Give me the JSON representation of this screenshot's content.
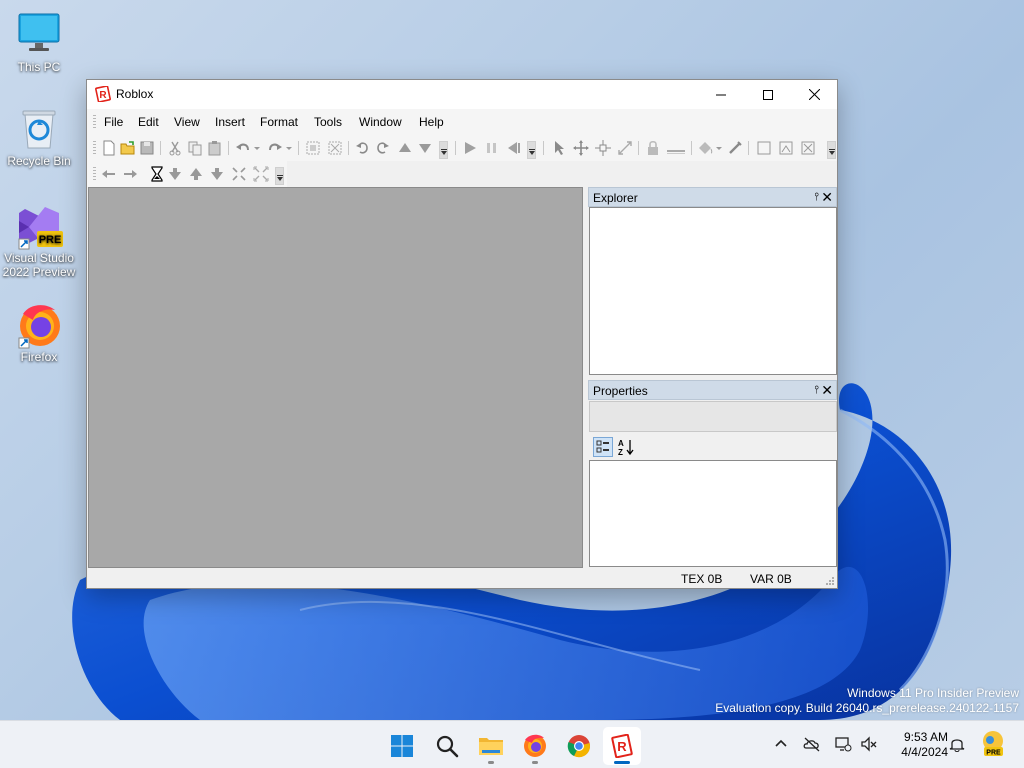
{
  "desktop": {
    "icons": [
      {
        "label": "This PC"
      },
      {
        "label": "Recycle Bin"
      },
      {
        "label_line1": "Visual Studio",
        "label_line2": "2022 Preview",
        "badge": "PRE"
      },
      {
        "label": "Firefox"
      }
    ],
    "watermark": {
      "line1": "Windows 11 Pro Insider Preview",
      "line2": "Evaluation copy. Build 26040.rs_prerelease.240122-1157"
    }
  },
  "window": {
    "title": "Roblox",
    "menu": [
      "File",
      "Edit",
      "View",
      "Insert",
      "Format",
      "Tools",
      "Window",
      "Help"
    ],
    "explorer": {
      "title": "Explorer",
      "pin_glyph": "⫯",
      "close_glyph": "✕"
    },
    "properties": {
      "title": "Properties",
      "pin_glyph": "⫯",
      "close_glyph": "✕"
    },
    "status": {
      "tex": "TEX 0B",
      "var": "VAR 0B"
    }
  },
  "taskbar": {
    "apps": [
      "start",
      "search",
      "file-explorer",
      "firefox",
      "chrome",
      "roblox"
    ],
    "active_app": "roblox",
    "clock": {
      "time": "9:53 AM",
      "date": "4/4/2024"
    },
    "tray_badge": "PRE"
  },
  "colors": {
    "accent": "#0067c0",
    "roblox_red": "#e2231a",
    "viewport": "#a8a8a8",
    "panel_header": "#cfdbe8"
  }
}
